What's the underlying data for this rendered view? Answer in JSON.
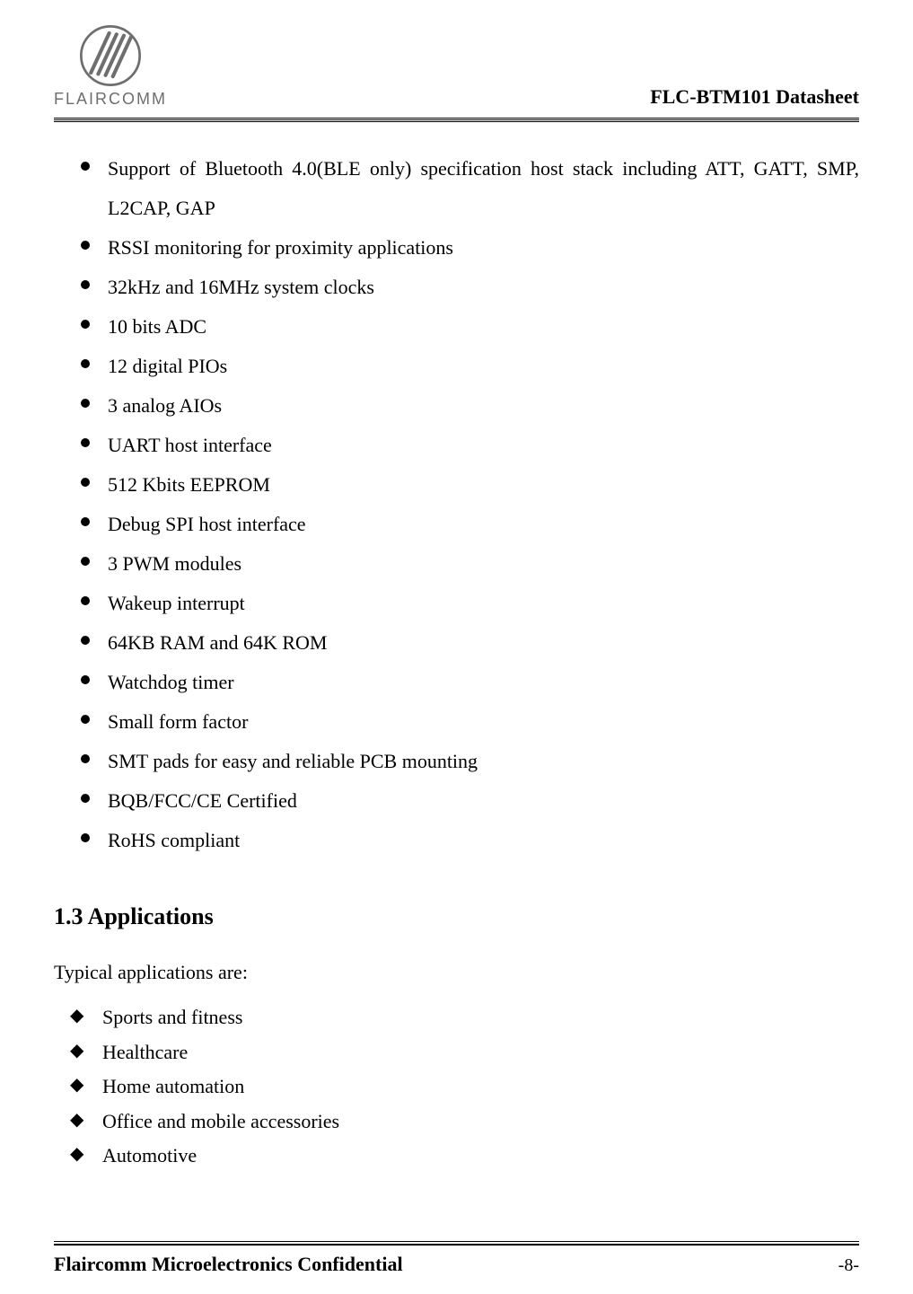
{
  "header": {
    "logo_text": "FLAIRCOMM",
    "doc_title": "FLC-BTM101 Datasheet"
  },
  "features": [
    "Support of  Bluetooth 4.0(BLE only) specification host stack including ATT, GATT, SMP, L2CAP, GAP",
    "RSSI monitoring for proximity applications",
    "32kHz and 16MHz system clocks",
    "10 bits ADC",
    "12 digital PIOs",
    "3 analog AIOs",
    "UART host interface",
    "512 Kbits EEPROM",
    "Debug SPI host interface",
    "3 PWM modules",
    "Wakeup interrupt",
    "64KB RAM and 64K ROM",
    "Watchdog timer",
    "Small form factor",
    "SMT pads for easy and reliable PCB mounting",
    "BQB/FCC/CE Certified",
    "RoHS compliant"
  ],
  "section": {
    "heading": "1.3  Applications",
    "intro": "Typical applications are:"
  },
  "applications": [
    "Sports and fitness",
    "Healthcare",
    "Home automation",
    "Office and mobile accessories",
    "Automotive"
  ],
  "footer": {
    "left": "Flaircomm Microelectronics Confidential",
    "right": "-8-"
  }
}
